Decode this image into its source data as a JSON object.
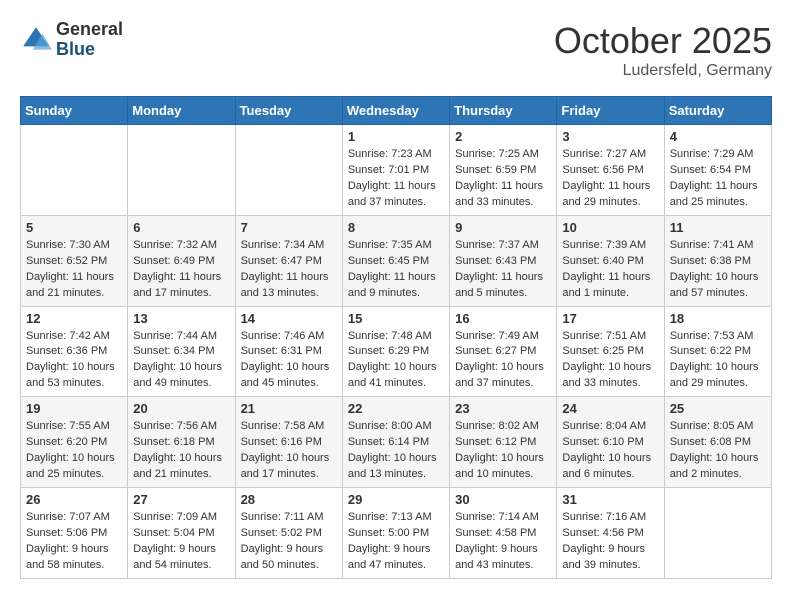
{
  "logo": {
    "general": "General",
    "blue": "Blue"
  },
  "title": "October 2025",
  "location": "Ludersfeld, Germany",
  "days_header": [
    "Sunday",
    "Monday",
    "Tuesday",
    "Wednesday",
    "Thursday",
    "Friday",
    "Saturday"
  ],
  "weeks": [
    [
      {
        "day": "",
        "info": ""
      },
      {
        "day": "",
        "info": ""
      },
      {
        "day": "",
        "info": ""
      },
      {
        "day": "1",
        "info": "Sunrise: 7:23 AM\nSunset: 7:01 PM\nDaylight: 11 hours\nand 37 minutes."
      },
      {
        "day": "2",
        "info": "Sunrise: 7:25 AM\nSunset: 6:59 PM\nDaylight: 11 hours\nand 33 minutes."
      },
      {
        "day": "3",
        "info": "Sunrise: 7:27 AM\nSunset: 6:56 PM\nDaylight: 11 hours\nand 29 minutes."
      },
      {
        "day": "4",
        "info": "Sunrise: 7:29 AM\nSunset: 6:54 PM\nDaylight: 11 hours\nand 25 minutes."
      }
    ],
    [
      {
        "day": "5",
        "info": "Sunrise: 7:30 AM\nSunset: 6:52 PM\nDaylight: 11 hours\nand 21 minutes."
      },
      {
        "day": "6",
        "info": "Sunrise: 7:32 AM\nSunset: 6:49 PM\nDaylight: 11 hours\nand 17 minutes."
      },
      {
        "day": "7",
        "info": "Sunrise: 7:34 AM\nSunset: 6:47 PM\nDaylight: 11 hours\nand 13 minutes."
      },
      {
        "day": "8",
        "info": "Sunrise: 7:35 AM\nSunset: 6:45 PM\nDaylight: 11 hours\nand 9 minutes."
      },
      {
        "day": "9",
        "info": "Sunrise: 7:37 AM\nSunset: 6:43 PM\nDaylight: 11 hours\nand 5 minutes."
      },
      {
        "day": "10",
        "info": "Sunrise: 7:39 AM\nSunset: 6:40 PM\nDaylight: 11 hours\nand 1 minute."
      },
      {
        "day": "11",
        "info": "Sunrise: 7:41 AM\nSunset: 6:38 PM\nDaylight: 10 hours\nand 57 minutes."
      }
    ],
    [
      {
        "day": "12",
        "info": "Sunrise: 7:42 AM\nSunset: 6:36 PM\nDaylight: 10 hours\nand 53 minutes."
      },
      {
        "day": "13",
        "info": "Sunrise: 7:44 AM\nSunset: 6:34 PM\nDaylight: 10 hours\nand 49 minutes."
      },
      {
        "day": "14",
        "info": "Sunrise: 7:46 AM\nSunset: 6:31 PM\nDaylight: 10 hours\nand 45 minutes."
      },
      {
        "day": "15",
        "info": "Sunrise: 7:48 AM\nSunset: 6:29 PM\nDaylight: 10 hours\nand 41 minutes."
      },
      {
        "day": "16",
        "info": "Sunrise: 7:49 AM\nSunset: 6:27 PM\nDaylight: 10 hours\nand 37 minutes."
      },
      {
        "day": "17",
        "info": "Sunrise: 7:51 AM\nSunset: 6:25 PM\nDaylight: 10 hours\nand 33 minutes."
      },
      {
        "day": "18",
        "info": "Sunrise: 7:53 AM\nSunset: 6:22 PM\nDaylight: 10 hours\nand 29 minutes."
      }
    ],
    [
      {
        "day": "19",
        "info": "Sunrise: 7:55 AM\nSunset: 6:20 PM\nDaylight: 10 hours\nand 25 minutes."
      },
      {
        "day": "20",
        "info": "Sunrise: 7:56 AM\nSunset: 6:18 PM\nDaylight: 10 hours\nand 21 minutes."
      },
      {
        "day": "21",
        "info": "Sunrise: 7:58 AM\nSunset: 6:16 PM\nDaylight: 10 hours\nand 17 minutes."
      },
      {
        "day": "22",
        "info": "Sunrise: 8:00 AM\nSunset: 6:14 PM\nDaylight: 10 hours\nand 13 minutes."
      },
      {
        "day": "23",
        "info": "Sunrise: 8:02 AM\nSunset: 6:12 PM\nDaylight: 10 hours\nand 10 minutes."
      },
      {
        "day": "24",
        "info": "Sunrise: 8:04 AM\nSunset: 6:10 PM\nDaylight: 10 hours\nand 6 minutes."
      },
      {
        "day": "25",
        "info": "Sunrise: 8:05 AM\nSunset: 6:08 PM\nDaylight: 10 hours\nand 2 minutes."
      }
    ],
    [
      {
        "day": "26",
        "info": "Sunrise: 7:07 AM\nSunset: 5:06 PM\nDaylight: 9 hours\nand 58 minutes."
      },
      {
        "day": "27",
        "info": "Sunrise: 7:09 AM\nSunset: 5:04 PM\nDaylight: 9 hours\nand 54 minutes."
      },
      {
        "day": "28",
        "info": "Sunrise: 7:11 AM\nSunset: 5:02 PM\nDaylight: 9 hours\nand 50 minutes."
      },
      {
        "day": "29",
        "info": "Sunrise: 7:13 AM\nSunset: 5:00 PM\nDaylight: 9 hours\nand 47 minutes."
      },
      {
        "day": "30",
        "info": "Sunrise: 7:14 AM\nSunset: 4:58 PM\nDaylight: 9 hours\nand 43 minutes."
      },
      {
        "day": "31",
        "info": "Sunrise: 7:16 AM\nSunset: 4:56 PM\nDaylight: 9 hours\nand 39 minutes."
      },
      {
        "day": "",
        "info": ""
      }
    ]
  ]
}
